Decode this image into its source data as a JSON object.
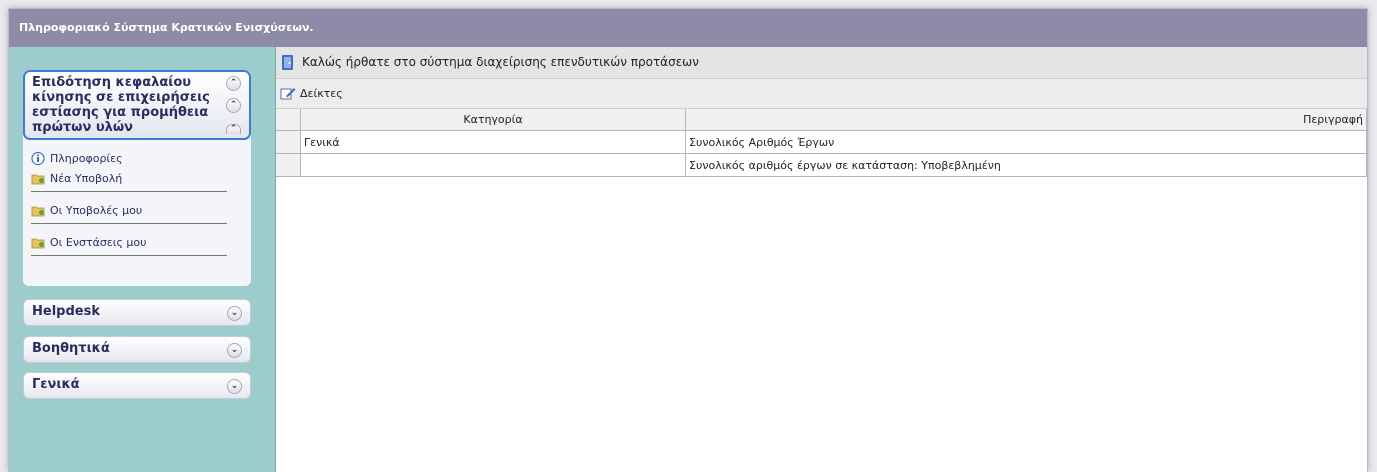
{
  "app": {
    "title": "Πληροφοριακό Σύστημα Κρατικών Ενισχύσεων."
  },
  "sidebar": {
    "open_panel": {
      "title": "Επιδότηση κεφαλαίου κίνησης σε επιχειρήσεις εστίασης για προμήθεια πρώτων υλών",
      "items": [
        {
          "label": "Πληροφορίες",
          "icon": "info-icon"
        },
        {
          "label": "Νέα Υποβολή",
          "icon": "folder-icon"
        },
        {
          "label": "Οι Υποβολές μου",
          "icon": "folder-icon"
        },
        {
          "label": "Οι Ενστάσεις μου",
          "icon": "folder-icon"
        }
      ]
    },
    "collapsed_panels": [
      {
        "label": "Helpdesk"
      },
      {
        "label": "Βοηθητικά"
      },
      {
        "label": "Γενικά"
      }
    ]
  },
  "main": {
    "welcome": "Καλώς ήρθατε στο σύστημα διαχείρισης επενδυτικών προτάσεων",
    "toolbar_label": "Δείκτες",
    "table": {
      "columns": [
        "Κατηγορία",
        "Περιγραφή"
      ],
      "rows": [
        [
          "Γενικά",
          "Συνολικός Αριθμός Έργων"
        ],
        [
          "",
          "Συνολικός αριθμός έργων σε κατάσταση: Υποβεβλημένη"
        ]
      ]
    }
  },
  "colors": {
    "titlebar": "#8e8ba8",
    "sidebar_bg": "#9ccccc",
    "panel_border": "#3c7bd9",
    "text_dark": "#2a2d63"
  }
}
